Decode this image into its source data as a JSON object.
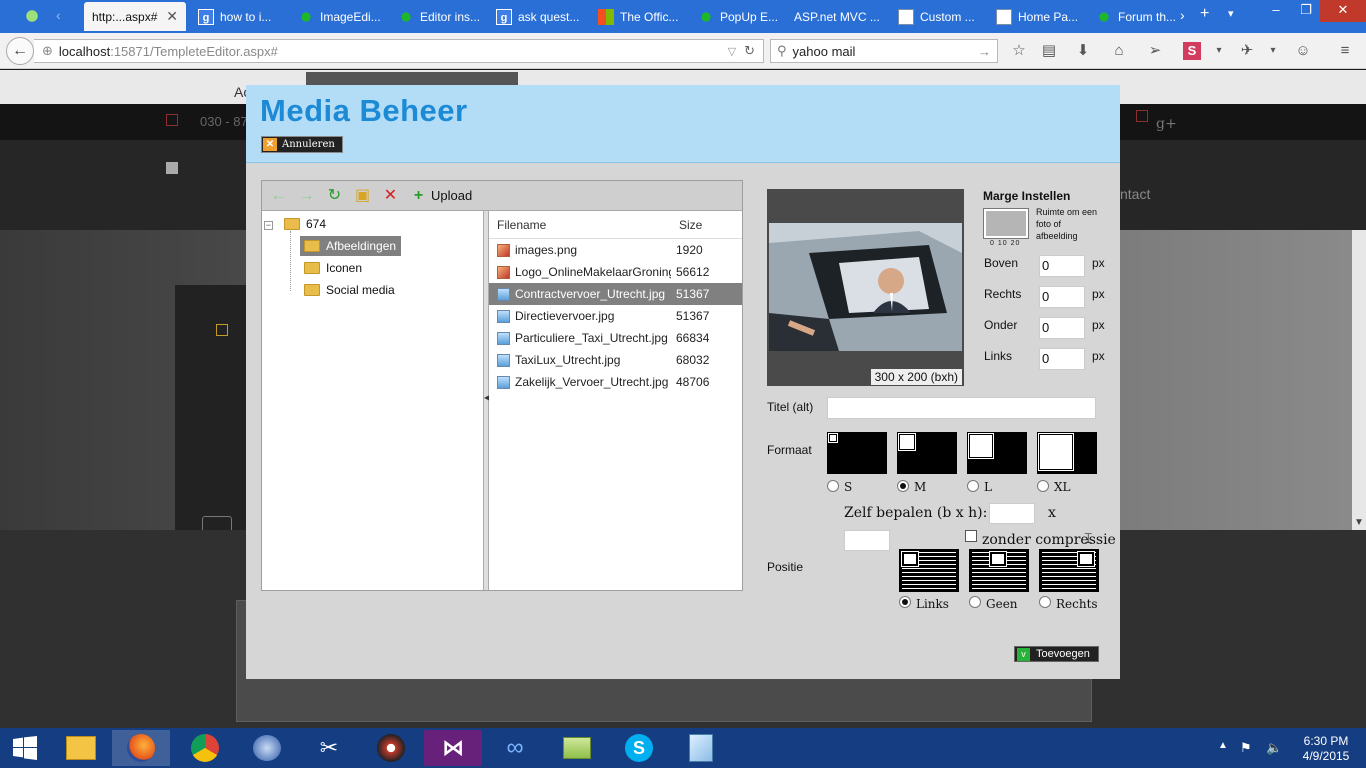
{
  "browser": {
    "tabs": [
      {
        "label": "http:...aspx#",
        "icon": "page-icon",
        "active": true
      },
      {
        "label": "how to i...",
        "icon": "google-icon"
      },
      {
        "label": "ImageEdi...",
        "icon": "frog-icon"
      },
      {
        "label": "Editor ins...",
        "icon": "frog-icon"
      },
      {
        "label": "ask quest...",
        "icon": "google-icon"
      },
      {
        "label": "The Offic...",
        "icon": "microsoft-icon"
      },
      {
        "label": "PopUp E...",
        "icon": "frog-icon"
      },
      {
        "label": "ASP.net MVC ...",
        "icon": "none"
      },
      {
        "label": "Custom ...",
        "icon": "doc-icon"
      },
      {
        "label": "Home Pa...",
        "icon": "doc-icon"
      },
      {
        "label": "Forum th...",
        "icon": "frog-icon"
      }
    ],
    "url_host": "localhost",
    "url_rest": ":15871/TempleteEditor.aspx#",
    "search_value": "yahoo mail"
  },
  "modal": {
    "title": "Media Beheer",
    "cancel_label": "Annuleren",
    "toolbar": {
      "upload_label": "Upload"
    },
    "tree": {
      "root": "674",
      "children": [
        "Afbeeldingen",
        "Iconen",
        "Social media"
      ],
      "selected": "Afbeeldingen"
    },
    "files": {
      "col_name": "Filename",
      "col_size": "Size",
      "rows": [
        {
          "name": "images.png",
          "size": "1920",
          "type": "png"
        },
        {
          "name": "Logo_OnlineMakelaarGroning",
          "size": "56612",
          "type": "png"
        },
        {
          "name": "Contractvervoer_Utrecht.jpg",
          "size": "51367",
          "type": "jpg",
          "selected": true
        },
        {
          "name": "Directievervoer.jpg",
          "size": "51367",
          "type": "jpg"
        },
        {
          "name": "Particuliere_Taxi_Utrecht.jpg",
          "size": "66834",
          "type": "jpg"
        },
        {
          "name": "TaxiLux_Utrecht.jpg",
          "size": "68032",
          "type": "jpg"
        },
        {
          "name": "Zakelijk_Vervoer_Utrecht.jpg",
          "size": "48706",
          "type": "jpg"
        }
      ]
    },
    "preview_dims": "300 x 200 (bxh)",
    "margin": {
      "title": "Marge Instellen",
      "hint": "Ruimte om een foto of afbeelding",
      "nums": "0 10 20",
      "fields": [
        {
          "label": "Boven",
          "value": "0",
          "unit": "px"
        },
        {
          "label": "Rechts",
          "value": "0",
          "unit": "px"
        },
        {
          "label": "Onder",
          "value": "0",
          "unit": "px"
        },
        {
          "label": "Links",
          "value": "0",
          "unit": "px"
        }
      ]
    },
    "alt_label": "Titel (alt)",
    "alt_value": "",
    "format": {
      "label": "Formaat",
      "options": [
        "S",
        "M",
        "L",
        "XL"
      ],
      "selected": "M"
    },
    "custom_size_label": "Zelf bepalen (b x h):",
    "custom_size_x": "x",
    "no_compression_label": "zonder compressie",
    "position": {
      "label": "Positie",
      "options": [
        "Links",
        "Geen",
        "Rechts"
      ],
      "selected": "Links"
    },
    "add_label": "Toevoegen"
  },
  "page_behind": {
    "phone_text": "030 - 87",
    "contact_text": "ntact",
    "top_text": "Ac"
  },
  "taskbar": {
    "apps": [
      "windows-start-icon",
      "file-explorer-icon",
      "firefox-icon",
      "chrome-icon",
      "thunderbird-icon",
      "tools-icon",
      "media-player-icon",
      "visual-studio-icon",
      "infinity-app-icon",
      "folder-app-icon",
      "skype-icon",
      "notepad-icon"
    ],
    "time": "6:30 PM",
    "date": "4/9/2015"
  },
  "colors": {
    "title_blue": "#1d8ad6",
    "header_bg": "#b3dcf7",
    "taskbar": "#153d82",
    "tabbar": "#2a6fd6"
  }
}
